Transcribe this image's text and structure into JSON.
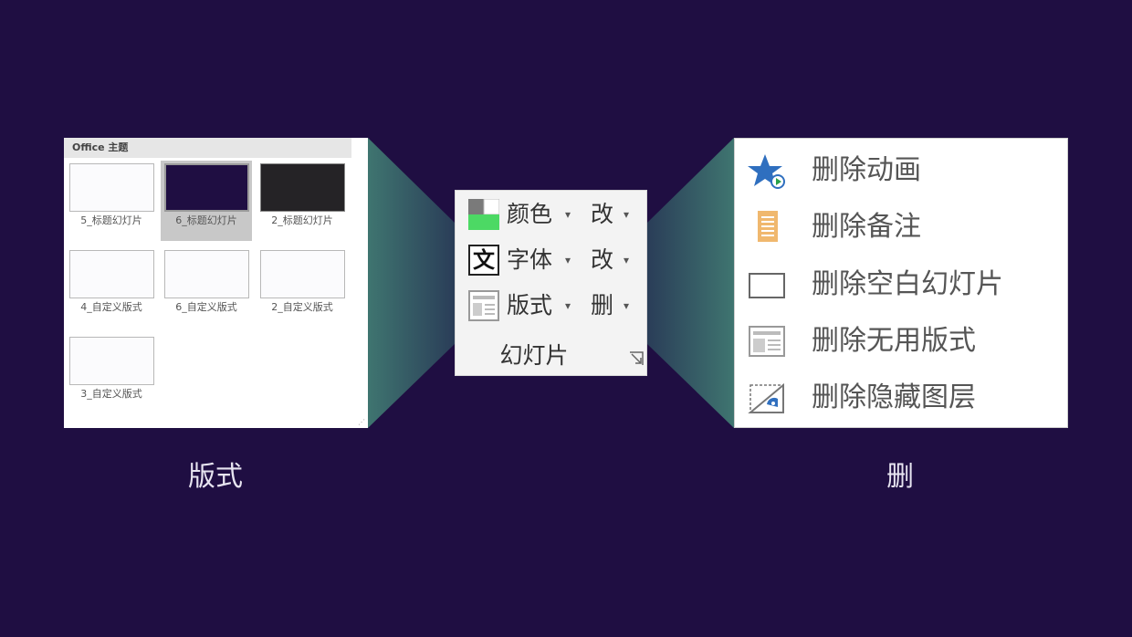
{
  "background_color": "#1f0e42",
  "layout_panel": {
    "header": "Office 主题",
    "thumbnails": [
      {
        "label": "5_标题幻灯片",
        "fill": "#fbfbfd",
        "selected": false
      },
      {
        "label": "6_标题幻灯片",
        "fill": "#1f0e42",
        "selected": true
      },
      {
        "label": "2_标题幻灯片",
        "fill": "#252326",
        "selected": false
      },
      {
        "label": "4_自定义版式",
        "fill": "#fbfbfd",
        "selected": false
      },
      {
        "label": "6_自定义版式",
        "fill": "#fbfbfd",
        "selected": false
      },
      {
        "label": "2_自定义版式",
        "fill": "#fbfbfd",
        "selected": false
      },
      {
        "label": "3_自定义版式",
        "fill": "#fbfbfd",
        "selected": false
      }
    ]
  },
  "ribbon": {
    "rows": [
      {
        "icon": "color-icon",
        "label": "颜色",
        "label2": "改",
        "arrow": "▾"
      },
      {
        "icon": "font-icon",
        "label": "字体",
        "label2": "改",
        "arrow": "▾"
      },
      {
        "icon": "layout-icon",
        "label": "版式",
        "label2": "删",
        "arrow": "▾"
      }
    ],
    "font_icon_glyph": "文",
    "group_label": "幻灯片"
  },
  "delete_menu": {
    "items": [
      {
        "icon": "star-animation-icon",
        "label": "删除动画"
      },
      {
        "icon": "notes-icon",
        "label": "删除备注"
      },
      {
        "icon": "blank-slide-icon",
        "label": "删除空白幻灯片"
      },
      {
        "icon": "layout-slide-icon",
        "label": "删除无用版式"
      },
      {
        "icon": "hidden-layer-icon",
        "label": "删除隐藏图层"
      }
    ]
  },
  "captions": {
    "left": "版式",
    "right": "删"
  },
  "colors": {
    "accent_blue": "#2f78c4",
    "notes_orange": "#f0b86e",
    "color_icon_green": "#4cd964",
    "cone": "#3d6f6e"
  }
}
